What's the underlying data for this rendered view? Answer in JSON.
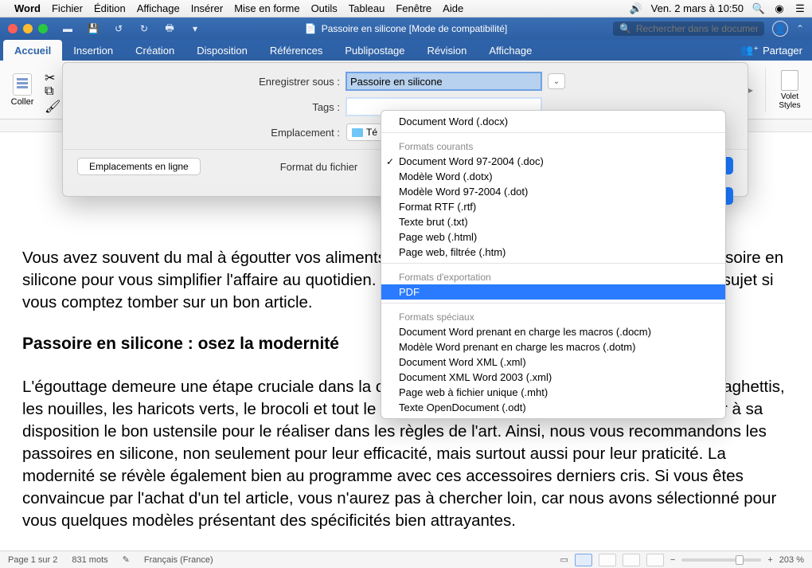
{
  "menubar": {
    "app": "Word",
    "items": [
      "Fichier",
      "Édition",
      "Affichage",
      "Insérer",
      "Mise en forme",
      "Outils",
      "Tableau",
      "Fenêtre",
      "Aide"
    ],
    "clock": "Ven. 2 mars à  10:50"
  },
  "titlebar": {
    "title": "Passoire en silicone [Mode de compatibilité]",
    "search_placeholder": "Rechercher dans le document"
  },
  "ribbon": {
    "tabs": [
      "Accueil",
      "Insertion",
      "Création",
      "Disposition",
      "Références",
      "Publipostage",
      "Révision",
      "Affichage"
    ],
    "active": 0,
    "share": "Partager",
    "paste": "Coller",
    "styles_pane": "Volet Styles"
  },
  "sheet": {
    "save_as_label": "Enregistrer sous :",
    "save_as_value": "Passoire en silicone",
    "tags_label": "Tags :",
    "loc_label": "Emplacement :",
    "loc_value": "Té",
    "online_locations": "Emplacements en ligne",
    "format_label": "Format du fichier"
  },
  "format_menu": {
    "top_option": "Document Word (.docx)",
    "groups": [
      {
        "title": "Formats courants",
        "options": [
          {
            "label": "Document Word 97-2004 (.doc)",
            "checked": true
          },
          {
            "label": "Modèle Word (.dotx)"
          },
          {
            "label": "Modèle Word 97-2004 (.dot)"
          },
          {
            "label": "Format RTF (.rtf)"
          },
          {
            "label": "Texte brut (.txt)"
          },
          {
            "label": "Page web (.html)"
          },
          {
            "label": "Page web, filtrée (.htm)"
          }
        ]
      },
      {
        "title": "Formats d'exportation",
        "options": [
          {
            "label": "PDF",
            "selected": true
          }
        ]
      },
      {
        "title": "Formats spéciaux",
        "options": [
          {
            "label": "Document Word prenant en charge les macros (.docm)"
          },
          {
            "label": "Modèle Word prenant en charge les macros (.dotm)"
          },
          {
            "label": "Document Word XML (.xml)"
          },
          {
            "label": "Document XML Word 2003 (.xml)"
          },
          {
            "label": "Page web à fichier unique (.mht)"
          },
          {
            "label": "Texte OpenDocument (.odt)"
          }
        ]
      }
    ]
  },
  "document": {
    "p1": "Vous avez souvent du mal à égoutter vos aliments ? Nous vous proposons, dans ce cas, une passoire en silicone pour vous simplifier l'affaire au quotidien. Découvrez ci-joints nos meilleurs conseils à ce sujet si vous comptez tomber sur un bon article.",
    "h2": "Passoire en silicone : osez la modernité",
    "p2": "L'égouttage demeure une étape cruciale dans la cuisine, pour ne citer que le riz, les pâtes, les spaghettis, les nouilles, les haricots verts, le brocoli et tout le reste. Sur ce, il est hautement préférable d'avoir à sa disposition le bon ustensile pour le réaliser dans les règles de l'art. Ainsi, nous vous recommandons les passoires en silicone, non seulement pour leur efficacité, mais surtout aussi pour leur praticité. La modernité se révèle également bien au programme avec ces accessoires derniers cris. Si vous êtes convaincue par l'achat d'un tel article, vous n'aurez pas à chercher loin, car nous avons sélectionné pour vous quelques modèles présentant des spécificités bien attrayantes."
  },
  "statusbar": {
    "page": "Page 1 sur 2",
    "words": "831 mots",
    "language": "Français (France)",
    "zoom": "203 %"
  }
}
